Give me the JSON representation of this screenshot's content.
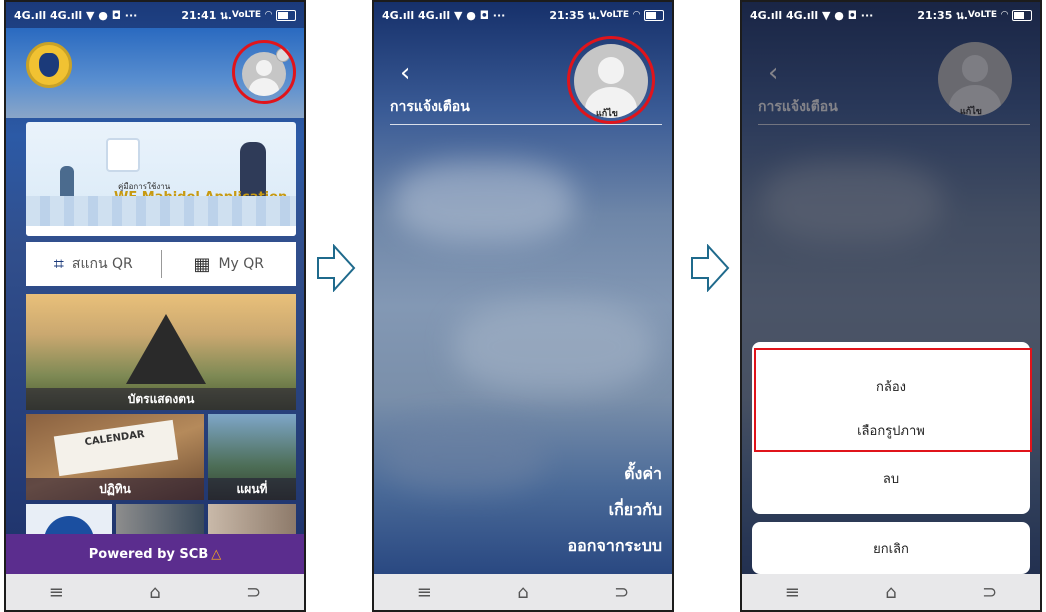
{
  "status_bars": [
    {
      "left": "4G.ıll 4G.ıll ▼ ● ◘ ···",
      "time": "21:41 น.",
      "right": "VoLTE"
    },
    {
      "left": "4G.ıll 4G.ıll ▼ ● ◘ ···",
      "time": "21:35 น.",
      "right": "VoLTE"
    },
    {
      "left": "4G.ıll 4G.ıll ▼ ● ◘ ···",
      "time": "21:35 น.",
      "right": "VoLTE"
    }
  ],
  "home": {
    "banner_line1": "คู่มือการใช้งาน",
    "banner_line2": "WE Mahidol Application",
    "qr_scan_label": "สแกน QR",
    "my_qr_label": "My QR",
    "tiles": [
      "บัตรแสดงตน",
      "ปฏิทิน",
      "แผนที่"
    ],
    "calendar_word": "CALENDAR",
    "powered": "Powered by SCB"
  },
  "profile": {
    "title": "การแจ้งเตือน",
    "edit_label": "แก้ไข",
    "menu": [
      "ตั้งค่า",
      "เกี่ยวกับ",
      "ออกจากระบบ"
    ]
  },
  "photo_sheet": {
    "options": [
      "กล้อง",
      "เลือกรูปภาพ",
      "ลบ"
    ],
    "cancel": "ยกเลิก"
  },
  "nav_icons": [
    "menu-icon",
    "home-icon",
    "back-icon"
  ],
  "colors": {
    "highlight": "#e0141b",
    "powered_bg": "#5b2d8e"
  }
}
